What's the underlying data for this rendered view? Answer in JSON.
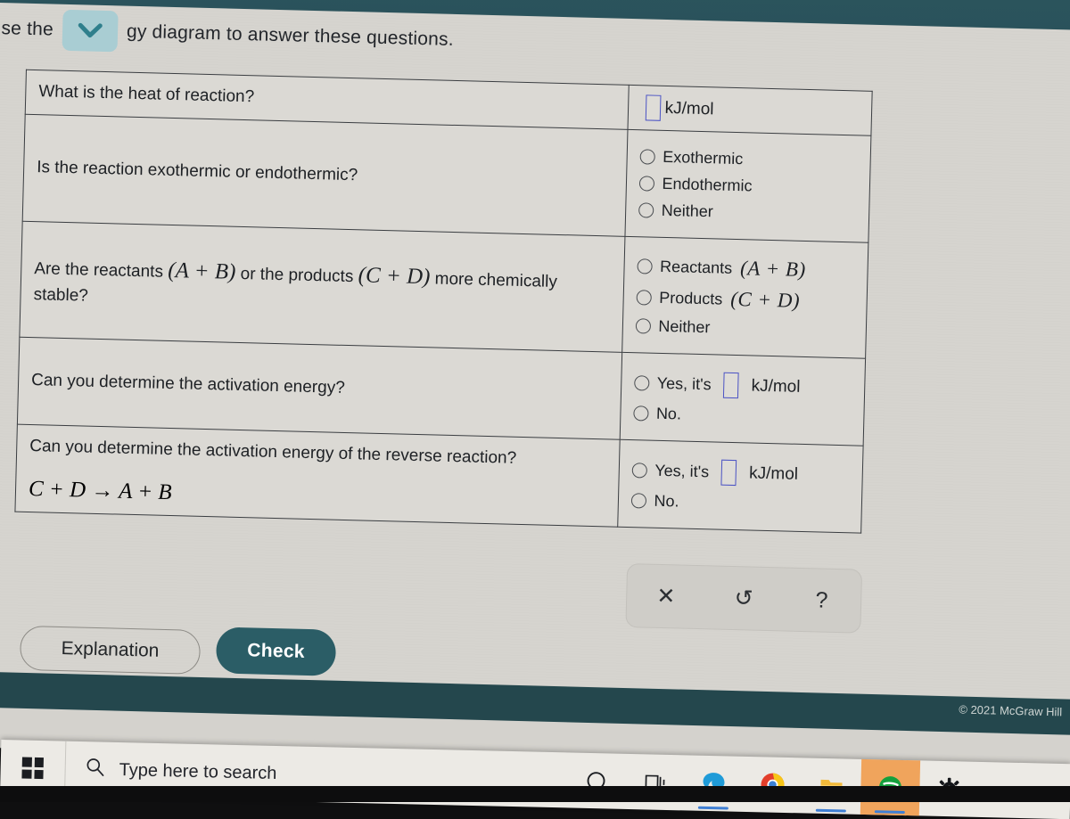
{
  "prompt": {
    "before": "Use the",
    "dropdown_icon": "chevron-down-icon",
    "after": "gy diagram to answer these questions."
  },
  "table": {
    "rows": [
      {
        "question": "What is the heat of reaction?",
        "answer_type": "input-with-unit",
        "input_value": "",
        "unit": "kJ/mol"
      },
      {
        "question": "Is the reaction exothermic or endothermic?",
        "answer_type": "radio-group",
        "options": [
          "Exothermic",
          "Endothermic",
          "Neither"
        ]
      },
      {
        "question_part1": "Are the reactants",
        "question_math1": "(A + B)",
        "question_part2": "or the products",
        "question_math2": "(C + D)",
        "question_part3": "more chemically stable?",
        "answer_type": "radio-group",
        "options": [
          "Reactants",
          "Products",
          "Neither"
        ],
        "option_math": [
          "(A + B)",
          "(C + D)",
          ""
        ]
      },
      {
        "question": "Can you determine the activation energy?",
        "answer_type": "radio-group-with-input",
        "option_yes": "Yes,  it's",
        "option_yes_unit": "kJ/mol",
        "input_value": "",
        "option_no": "No."
      },
      {
        "question": "Can you determine the activation energy of the reverse reaction?",
        "equation": "C + D → A + B",
        "answer_type": "radio-group-with-input",
        "option_yes": "Yes,  it's",
        "option_yes_unit": "kJ/mol",
        "input_value": "",
        "option_no": "No."
      }
    ]
  },
  "toolstrip": {
    "clear_label": "✕",
    "undo_label": "↺",
    "help_label": "?"
  },
  "actions": {
    "explanation_label": "Explanation",
    "check_label": "Check"
  },
  "footer": {
    "copyright": "© 2021 McGraw Hill"
  },
  "taskbar": {
    "search_placeholder": "Type here to search",
    "icons": [
      {
        "name": "cortana-icon"
      },
      {
        "name": "task-view-icon"
      },
      {
        "name": "edge-icon"
      },
      {
        "name": "chrome-icon"
      },
      {
        "name": "file-explorer-icon"
      },
      {
        "name": "spotify-icon"
      },
      {
        "name": "settings-gear-icon"
      }
    ]
  },
  "colors": {
    "header_teal": "#2d5a62",
    "check_button": "#2b5d66",
    "chevron_button": "#a9cdd3",
    "input_border": "#4b53c4",
    "page_bg": "#d6d4cf"
  }
}
